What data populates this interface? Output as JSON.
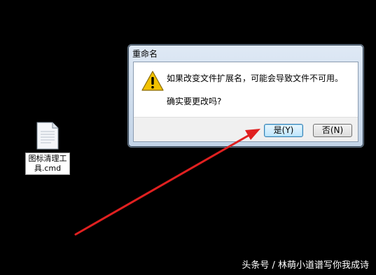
{
  "desktop": {
    "file_icon": {
      "label_line1": "图标清理工",
      "label_line2": "具.cmd",
      "icon": "file-icon"
    }
  },
  "dialog": {
    "title": "重命名",
    "message_line1": "如果改变文件扩展名，可能会导致文件不可用。",
    "message_line2": "确实要更改吗?",
    "icon": "warning-icon",
    "buttons": {
      "yes": "是(Y)",
      "no": "否(N)"
    }
  },
  "annotation": {
    "arrow_color": "#e02020"
  },
  "watermark": "头条号 / 林萌小道谱写你我成诗",
  "colors": {
    "background": "#000000",
    "warning": "#f2c200",
    "yes_button_highlight": "#3c7fb1"
  }
}
